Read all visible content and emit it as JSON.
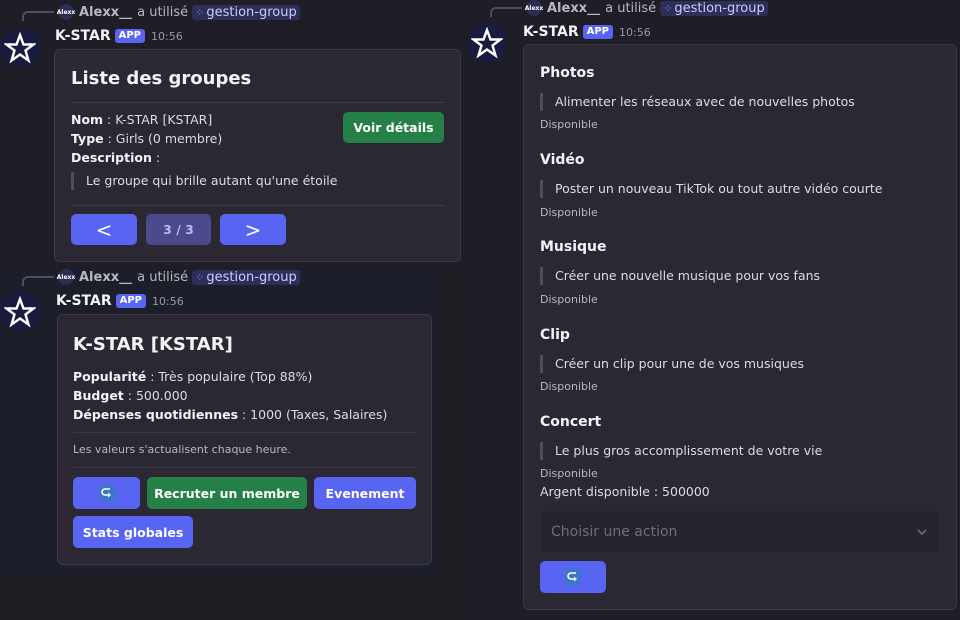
{
  "bot": {
    "name": "K-STAR",
    "tag": "APP",
    "time": "10:56"
  },
  "invoker": {
    "avatar_text": "Alexx",
    "name": "Alexx__",
    "used": "a utilisé",
    "command": "gestion-group"
  },
  "msg1": {
    "title": "Liste des groupes",
    "nom_label": "Nom",
    "nom_value": " : K-STAR [KSTAR]",
    "type_label": "Type",
    "type_value": " : Girls (0 membre)",
    "desc_label": "Description",
    "desc_value": " :",
    "quote": "Le groupe qui brille autant qu'une étoile",
    "details_button": "Voir détails",
    "prev_button": "<",
    "page_indicator": "3 / 3",
    "next_button": ">"
  },
  "msg2": {
    "title": "K-STAR [KSTAR]",
    "pop_label": "Popularité",
    "pop_value": " : Très populaire (Top 88%)",
    "budget_label": "Budget",
    "budget_value": " : 500.000",
    "dep_label": "Dépenses quotidiennes",
    "dep_value": " : 1000 (Taxes, Salaires)",
    "note": "Les valeurs s'actualisent chaque heure.",
    "recruit_button": "Recruter un membre",
    "event_button": "Evenement",
    "stats_button": "Stats globales"
  },
  "msg3": {
    "sections": [
      {
        "title": "Photos",
        "quote": "Alimenter les réseaux avec de nouvelles photos",
        "status": "Disponible"
      },
      {
        "title": "Vidéo",
        "quote": "Poster un nouveau TikTok ou tout autre vidéo courte",
        "status": "Disponible"
      },
      {
        "title": "Musique",
        "quote": "Créer une nouvelle musique pour vos fans",
        "status": "Disponible"
      },
      {
        "title": "Clip",
        "quote": "Créer un clip pour une de vos musiques",
        "status": "Disponible"
      },
      {
        "title": "Concert",
        "quote": "Le plus gros accomplissement de votre vie",
        "status": "Disponible"
      }
    ],
    "money": "Argent disponible : 500000",
    "select_placeholder": "Choisir une action"
  },
  "icons": {
    "avatar": "star-logo-icon",
    "refresh": "refresh-icon",
    "chevron": "chevron-down-icon",
    "slash": "slash-command-icon"
  },
  "colors": {
    "blurple": "#5865f2",
    "green": "#248046",
    "background": "#1e1e24",
    "card": "#2b2733"
  }
}
